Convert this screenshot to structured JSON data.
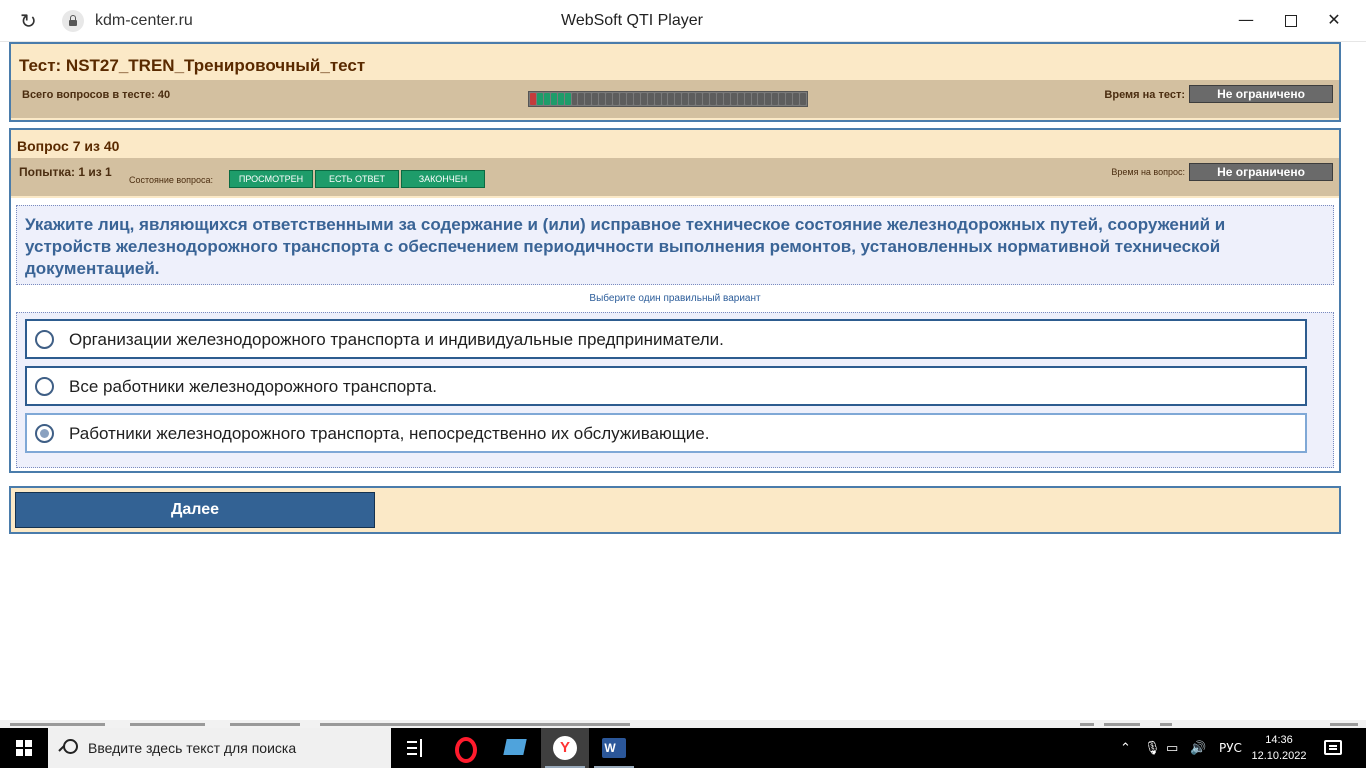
{
  "window": {
    "url": "kdm-center.ru",
    "title": "WebSoft QTI Player",
    "minimize_glyph": "—",
    "close_glyph": "✕",
    "refresh_glyph": "↻"
  },
  "test": {
    "title": "Тест: NST27_TREN_Тренировочный_тест",
    "total_label": "Всего вопросов в тесте: 40",
    "time_label": "Время на тест:",
    "time_value": "Не ограничено",
    "progress": {
      "total": 40,
      "current": 7,
      "answered": [
        2,
        3,
        4,
        5,
        6
      ]
    }
  },
  "question": {
    "number_label": "Вопрос 7 из 40",
    "attempt_label": "Попытка: 1 из 1",
    "state_label": "Состояние вопроса:",
    "states": [
      "ПРОСМОТРЕН",
      "ЕСТЬ ОТВЕТ",
      "ЗАКОНЧЕН"
    ],
    "time_label": "Время на вопрос:",
    "time_value": "Не ограничено",
    "text": "Укажите лиц, являющихся ответственными за содержание и (или) исправное техническое состояние железнодорожных путей, сооружений и устройств железнодорожного транспорта с обеспечением периодичности выполнения ремонтов, установленных нормативной технической документацией.",
    "hint": "Выберите один правильный вариант",
    "answers": [
      {
        "text": "Организации железнодорожного транспорта и индивидуальные предприниматели.",
        "selected": false
      },
      {
        "text": "Все работники железнодорожного транспорта.",
        "selected": false
      },
      {
        "text": "Работники железнодорожного транспорта, непосредственно их обслуживающие.",
        "selected": true
      }
    ]
  },
  "nav": {
    "next_label": "Далее"
  },
  "taskbar": {
    "search_placeholder": "Введите здесь текст для поиска",
    "lang": "РУС",
    "time": "14:36",
    "date": "12.10.2022",
    "tray_icons": [
      "chevron-up-icon",
      "microphone-icon",
      "battery-icon",
      "volume-icon"
    ]
  },
  "colors": {
    "panel_border": "#4a7cab",
    "panel_bg": "#fbe9c7",
    "band_bg": "#d3c0a0",
    "state_green": "#1e9c6a",
    "question_text": "#3a6496",
    "next_button": "#336294"
  }
}
